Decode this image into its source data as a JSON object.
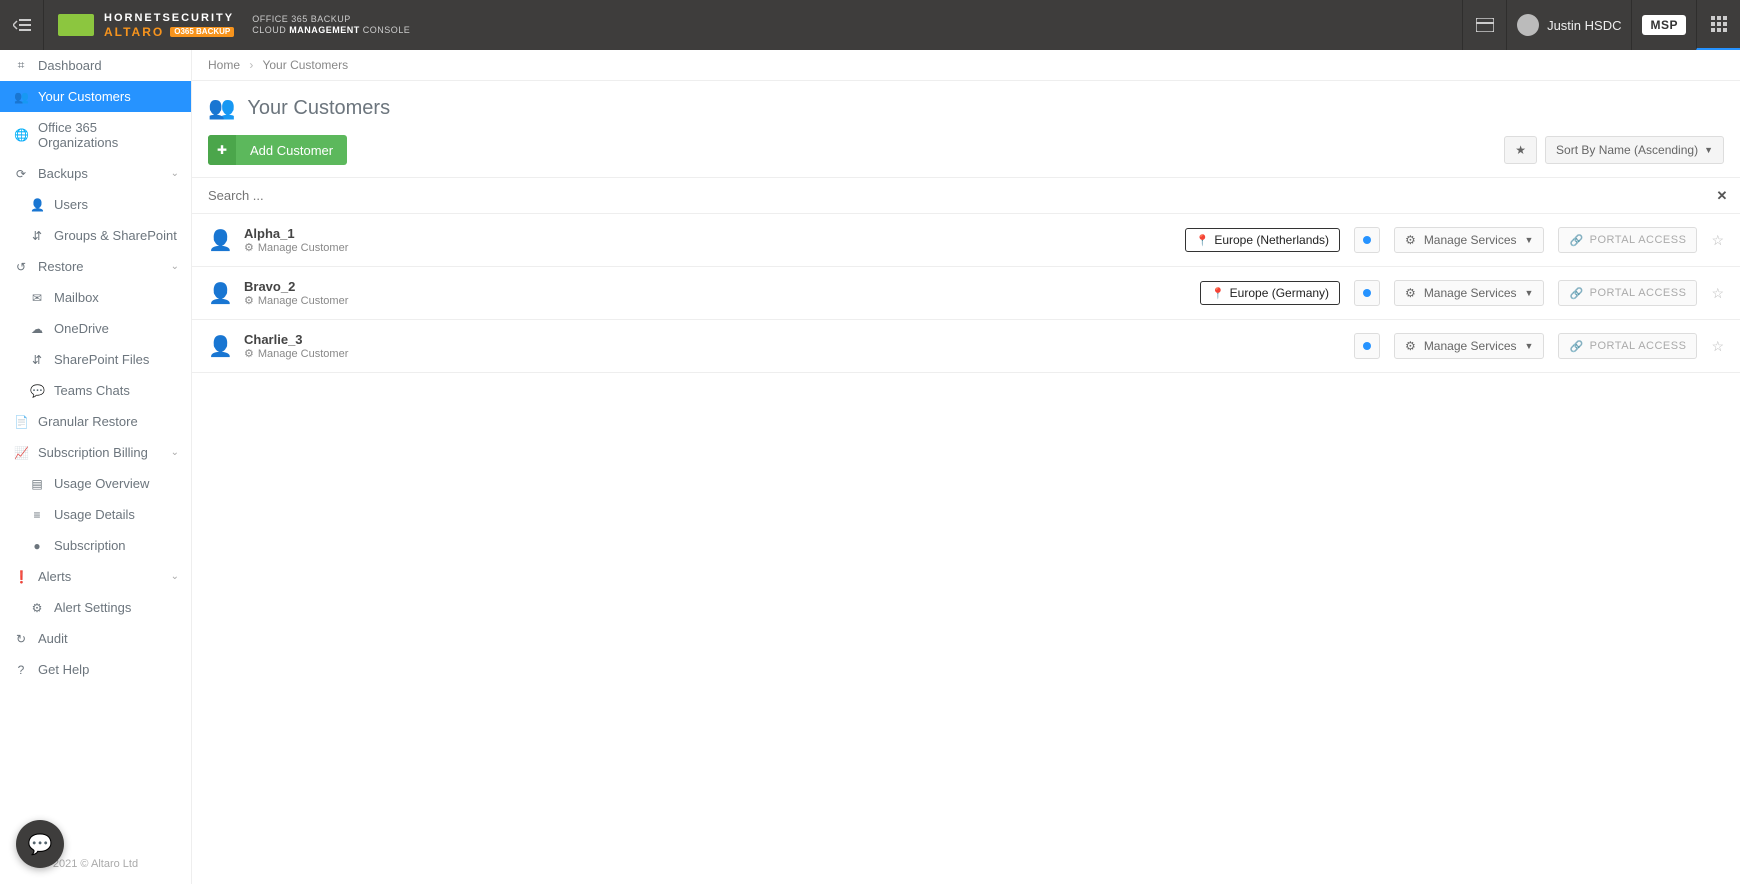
{
  "topbar": {
    "brand_line1": "HORNETSECURITY",
    "brand_altaro": "ALTARO",
    "brand_badge": "O365 BACKUP",
    "brand_prod_1": "OFFICE 365 BACKUP",
    "brand_prod_2": "CLOUD MANAGEMENT CONSOLE",
    "username": "Justin HSDC",
    "msp": "MSP"
  },
  "sidebar": {
    "items": [
      {
        "label": "Dashboard",
        "icon": "⌗"
      },
      {
        "label": "Your Customers",
        "icon": "👥",
        "active": true
      },
      {
        "label": "Office 365 Organizations",
        "icon": "🌐"
      },
      {
        "label": "Backups",
        "icon": "⟳",
        "expand": true
      },
      {
        "label": "Users",
        "icon": "👤",
        "sub": true
      },
      {
        "label": "Groups & SharePoint",
        "icon": "⇵",
        "sub": true
      },
      {
        "label": "Restore",
        "icon": "↺",
        "expand": true
      },
      {
        "label": "Mailbox",
        "icon": "✉",
        "sub": true
      },
      {
        "label": "OneDrive",
        "icon": "☁",
        "sub": true
      },
      {
        "label": "SharePoint Files",
        "icon": "⇵",
        "sub": true
      },
      {
        "label": "Teams Chats",
        "icon": "💬",
        "sub": true
      },
      {
        "label": "Granular Restore",
        "icon": "📄"
      },
      {
        "label": "Subscription Billing",
        "icon": "📈",
        "expand": true
      },
      {
        "label": "Usage Overview",
        "icon": "▤",
        "sub": true
      },
      {
        "label": "Usage Details",
        "icon": "≡",
        "sub": true
      },
      {
        "label": "Subscription",
        "icon": "●",
        "sub": true
      },
      {
        "label": "Alerts",
        "icon": "❗",
        "expand": true
      },
      {
        "label": "Alert Settings",
        "icon": "⚙",
        "sub": true
      },
      {
        "label": "Audit",
        "icon": "↻"
      },
      {
        "label": "Get Help",
        "icon": "?"
      }
    ],
    "footer": "2021  © Altaro Ltd"
  },
  "breadcrumb": {
    "home": "Home",
    "current": "Your Customers"
  },
  "page": {
    "title": "Your Customers",
    "add_label": "Add Customer",
    "sort_label": "Sort By Name (Ascending)",
    "search_placeholder": "Search ..."
  },
  "common": {
    "manage_customer": "Manage Customer",
    "manage_services": "Manage Services",
    "portal_access": "PORTAL ACCESS"
  },
  "customers": [
    {
      "name": "Alpha_1",
      "location": "Europe (Netherlands)"
    },
    {
      "name": "Bravo_2",
      "location": "Europe (Germany)"
    },
    {
      "name": "Charlie_3",
      "location": ""
    }
  ]
}
